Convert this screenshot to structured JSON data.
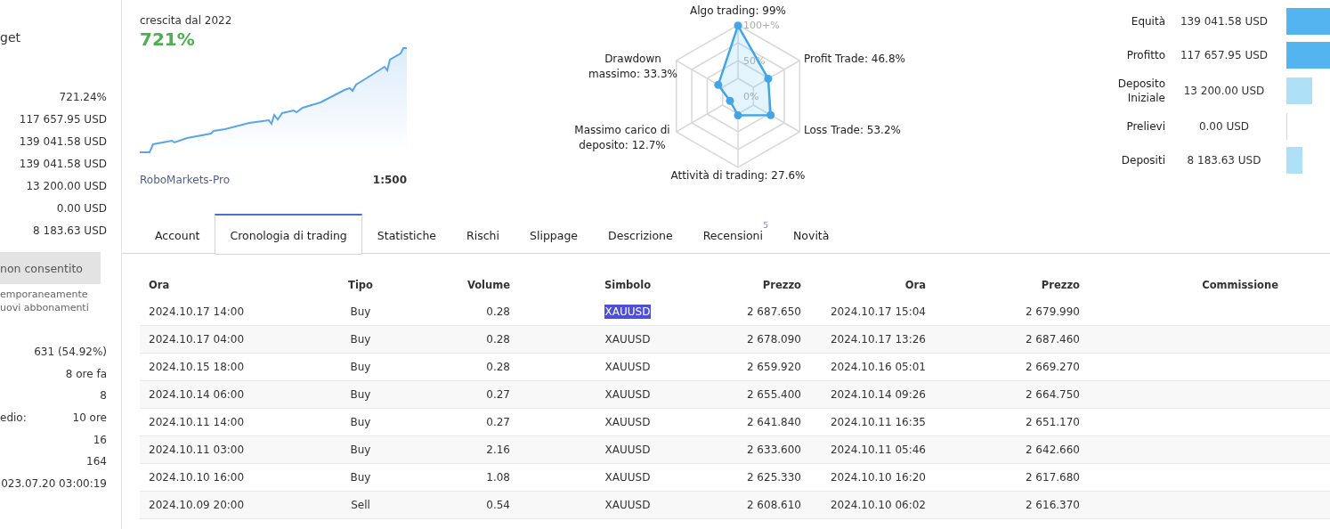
{
  "left_panel": {
    "heading": "get",
    "values": [
      "721.24%",
      "117 657.95 USD",
      "139 041.58 USD",
      "139 041.58 USD",
      "13 200.00 USD",
      "0.00 USD",
      "8 183.63 USD"
    ],
    "button": "non consentito",
    "note_lines": [
      "emporaneamente",
      "uovi abbonamenti"
    ],
    "stats": [
      {
        "value": "631 (54.92%)"
      },
      {
        "value": "8 ore fa"
      },
      {
        "value": "8"
      },
      {
        "label": "edio:",
        "value": "10 ore"
      },
      {
        "value": "16"
      },
      {
        "value": "164"
      },
      {
        "value": "023.07.20 03:00:19"
      }
    ]
  },
  "growth": {
    "caption": "crescita dal 2022",
    "value": "721%",
    "server": "RoboMarkets-Pro",
    "leverage": "1:500"
  },
  "radar": {
    "scale_labels": [
      "100+%",
      "50%",
      "0%"
    ],
    "axes": [
      {
        "label": "Algo trading: 99%"
      },
      {
        "label": "Drawdown massimo: 33.3%"
      },
      {
        "label": "Profit Trade: 46.8%"
      },
      {
        "label": "Massimo carico di deposito: 12.7%"
      },
      {
        "label": "Loss Trade: 53.2%"
      },
      {
        "label": "Attività di trading: 27.6%"
      }
    ]
  },
  "balance": [
    {
      "label": "Equità",
      "value": "139 041.58 USD",
      "color": "#53b4ef"
    },
    {
      "label": "Profitto",
      "value": "117 657.95 USD",
      "color": "#53b4ef"
    },
    {
      "label": "Deposito Iniziale",
      "value": "13 200.00 USD",
      "color": "#aee0f8"
    },
    {
      "label": "Prelievi",
      "value": "0.00 USD",
      "color": "#aee0f8"
    },
    {
      "label": "Depositi",
      "value": "8 183.63 USD",
      "color": "#aee0f8"
    }
  ],
  "tabs": [
    {
      "label": "Account",
      "selected": false
    },
    {
      "label": "Cronologia di trading",
      "selected": true
    },
    {
      "label": "Statistiche",
      "selected": false
    },
    {
      "label": "Rischi",
      "selected": false
    },
    {
      "label": "Slippage",
      "selected": false
    },
    {
      "label": "Descrizione",
      "selected": false
    },
    {
      "label": "Recensioni",
      "selected": false,
      "badge": "5"
    },
    {
      "label": "Novità",
      "selected": false
    }
  ],
  "table": {
    "columns": [
      "Ora",
      "Tipo",
      "Volume",
      "Simbolo",
      "Prezzo",
      "Ora",
      "Prezzo",
      "Commissione"
    ],
    "rows": [
      {
        "cells": [
          "2024.10.17 14:00",
          "Buy",
          "0.28",
          "XAUUSD",
          "2 687.650",
          "2024.10.17 15:04",
          "2 679.990"
        ],
        "symbol_highlighted": true
      },
      {
        "cells": [
          "2024.10.17 04:00",
          "Buy",
          "0.28",
          "XAUUSD",
          "2 678.090",
          "2024.10.17 13:26",
          "2 687.460"
        ],
        "symbol_highlighted": false
      },
      {
        "cells": [
          "2024.10.15 18:00",
          "Buy",
          "0.28",
          "XAUUSD",
          "2 659.920",
          "2024.10.16 05:01",
          "2 669.270"
        ],
        "symbol_highlighted": false
      },
      {
        "cells": [
          "2024.10.14 06:00",
          "Buy",
          "0.27",
          "XAUUSD",
          "2 655.400",
          "2024.10.14 09:26",
          "2 664.750"
        ],
        "symbol_highlighted": false
      },
      {
        "cells": [
          "2024.10.11 14:00",
          "Buy",
          "0.27",
          "XAUUSD",
          "2 641.840",
          "2024.10.11 16:35",
          "2 651.170"
        ],
        "symbol_highlighted": false
      },
      {
        "cells": [
          "2024.10.11 03:00",
          "Buy",
          "2.16",
          "XAUUSD",
          "2 633.600",
          "2024.10.11 05:46",
          "2 642.660"
        ],
        "symbol_highlighted": false
      },
      {
        "cells": [
          "2024.10.10 16:00",
          "Buy",
          "1.08",
          "XAUUSD",
          "2 625.330",
          "2024.10.10 16:20",
          "2 617.680"
        ],
        "symbol_highlighted": false
      },
      {
        "cells": [
          "2024.10.09 20:00",
          "Sell",
          "0.54",
          "XAUUSD",
          "2 608.610",
          "2024.10.10 06:02",
          "2 616.370"
        ],
        "symbol_highlighted": false
      }
    ]
  }
}
